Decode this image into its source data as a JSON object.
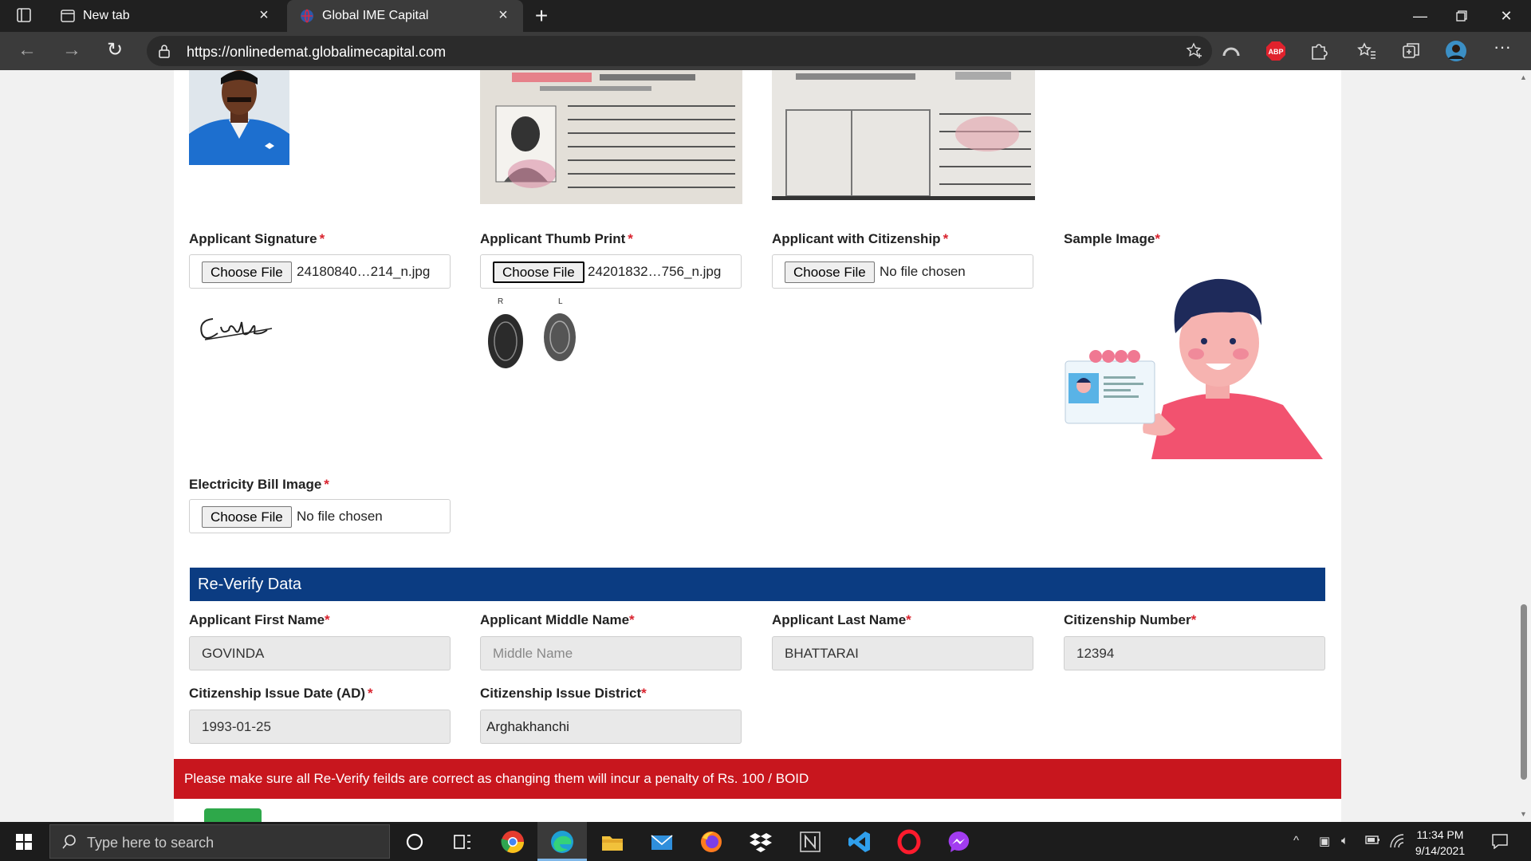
{
  "browser": {
    "tabs": [
      {
        "label": "New tab",
        "active": false
      },
      {
        "label": "Global IME Capital",
        "active": true
      }
    ],
    "url": "https://onlinedemat.globalimecapital.com",
    "extensions": [
      "abp-icon",
      "puzzle-icon"
    ]
  },
  "form": {
    "signature": {
      "label": "Applicant Signature",
      "required": "*",
      "button": "Choose File",
      "file": "24180840…214_n.jpg"
    },
    "thumb": {
      "label": "Applicant Thumb Print",
      "required": "*",
      "button": "Choose File",
      "file": "24201832…756_n.jpg",
      "letters": [
        "R",
        "L"
      ]
    },
    "with_citizenship": {
      "label": "Applicant with Citizenship",
      "required": "*",
      "button": "Choose File",
      "file": "No file chosen"
    },
    "sample": {
      "label": "Sample Image",
      "required": "*"
    },
    "electricity": {
      "label": "Electricity Bill Image",
      "required": "*",
      "button": "Choose File",
      "file": "No file chosen"
    }
  },
  "reverify": {
    "title": "Re-Verify Data",
    "first_name": {
      "label": "Applicant First Name",
      "required": "*",
      "value": "GOVINDA"
    },
    "middle_name": {
      "label": "Applicant Middle Name",
      "required": "*",
      "placeholder": "Middle Name"
    },
    "last_name": {
      "label": "Applicant Last Name",
      "required": "*",
      "value": "BHATTARAI"
    },
    "citizenship_number": {
      "label": "Citizenship Number",
      "required": "*",
      "value": "12394"
    },
    "issue_date": {
      "label": "Citizenship Issue Date (AD)",
      "required": "*",
      "value": "1993-01-25"
    },
    "issue_district": {
      "label": "Citizenship Issue District",
      "required": "*",
      "value": "Arghakhanchi"
    }
  },
  "warning": "Please make sure all Re-Verify feilds are correct as changing them will incur a penalty of Rs. 100 / BOID",
  "taskbar": {
    "search_placeholder": "Type here to search",
    "time": "11:34 PM",
    "date": "9/14/2021"
  },
  "colors": {
    "reverify_bar": "#0b3c82",
    "warning_bar": "#c8161e",
    "required": "#d9232e",
    "submit": "#2ea84a"
  }
}
